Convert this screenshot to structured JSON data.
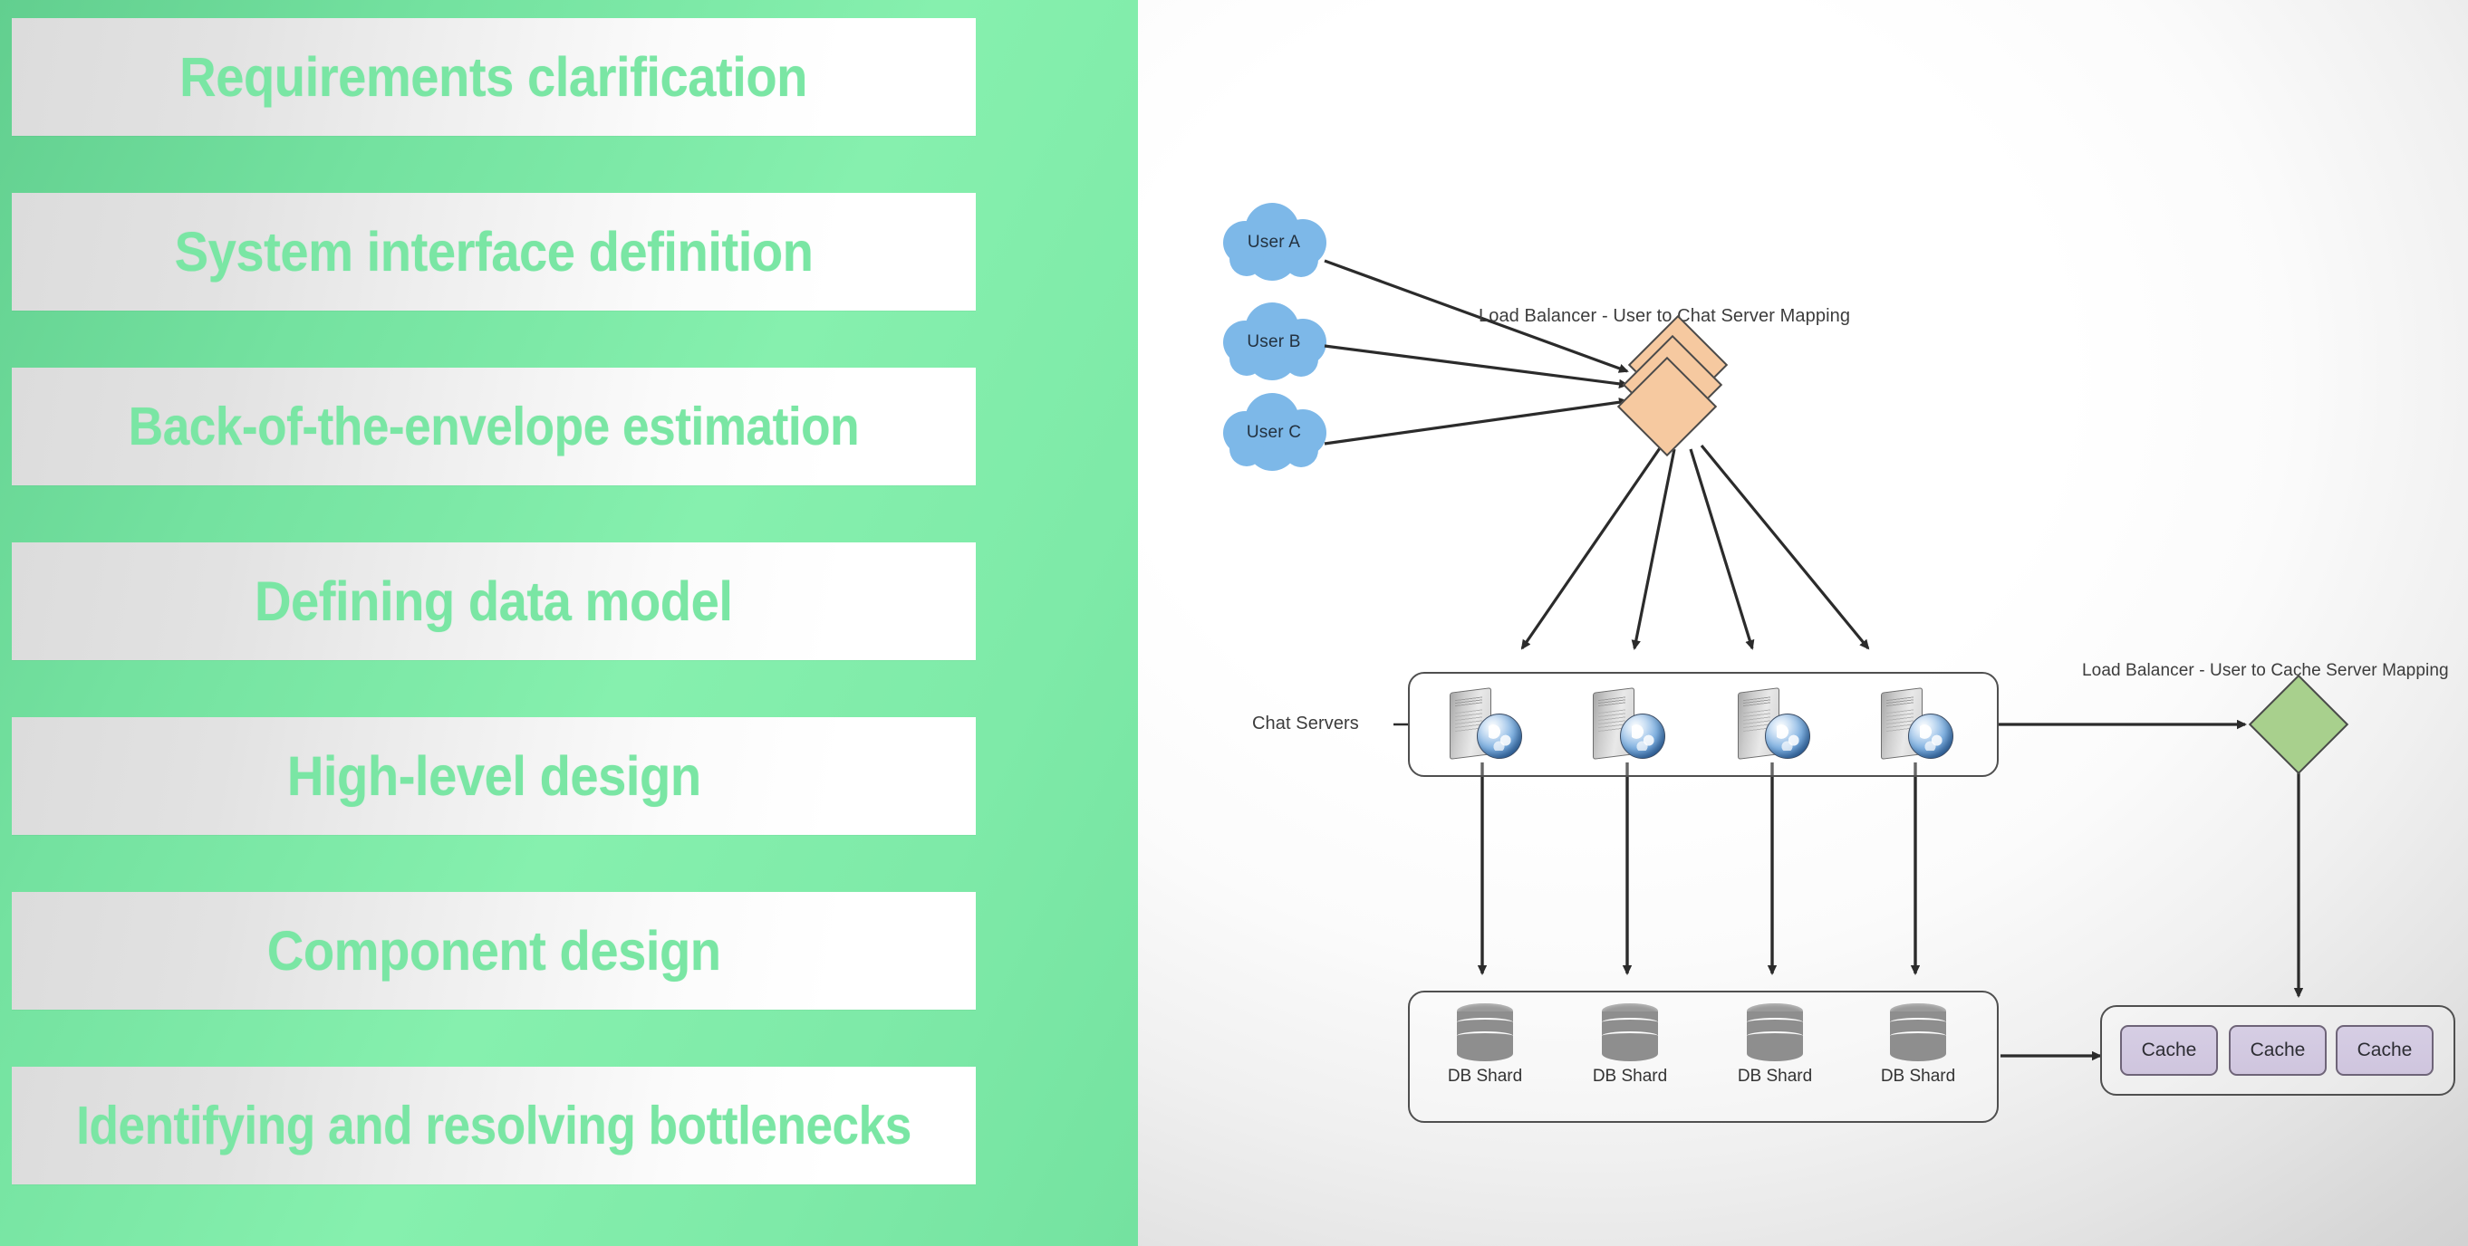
{
  "left_panel": {
    "background_color": "#7ce5a5",
    "text_color": "#7ae6a4",
    "steps": [
      {
        "label": "Requirements clarification"
      },
      {
        "label": "System interface definition"
      },
      {
        "label": "Back-of-the-envelope estimation"
      },
      {
        "label": "Defining data model"
      },
      {
        "label": "High-level design"
      },
      {
        "label": "Component design"
      },
      {
        "label": "Identifying and resolving bottlenecks"
      }
    ]
  },
  "diagram": {
    "users": [
      {
        "label": "User A"
      },
      {
        "label": "User B"
      },
      {
        "label": "User C"
      }
    ],
    "chat_load_balancer_label": "Load Balancer - User to Chat Server Mapping",
    "cache_load_balancer_label": "Load Balancer - User to Cache Server Mapping",
    "chat_servers_label": "Chat Servers",
    "chat_servers": [
      {
        "label": ""
      },
      {
        "label": ""
      },
      {
        "label": ""
      },
      {
        "label": ""
      }
    ],
    "db_shards": [
      {
        "label": "DB Shard"
      },
      {
        "label": "DB Shard"
      },
      {
        "label": "DB Shard"
      },
      {
        "label": "DB Shard"
      }
    ],
    "caches": [
      {
        "label": "Cache"
      },
      {
        "label": "Cache"
      },
      {
        "label": "Cache"
      }
    ],
    "colors": {
      "cloud": "#7db8e8",
      "chat_load_balancer": "#f6c9a0",
      "cache_load_balancer": "#a8d08d",
      "cache_chip": "#d2c8e0",
      "db_shard": "#8e8e8e",
      "connector": "#2b2b2b"
    }
  }
}
